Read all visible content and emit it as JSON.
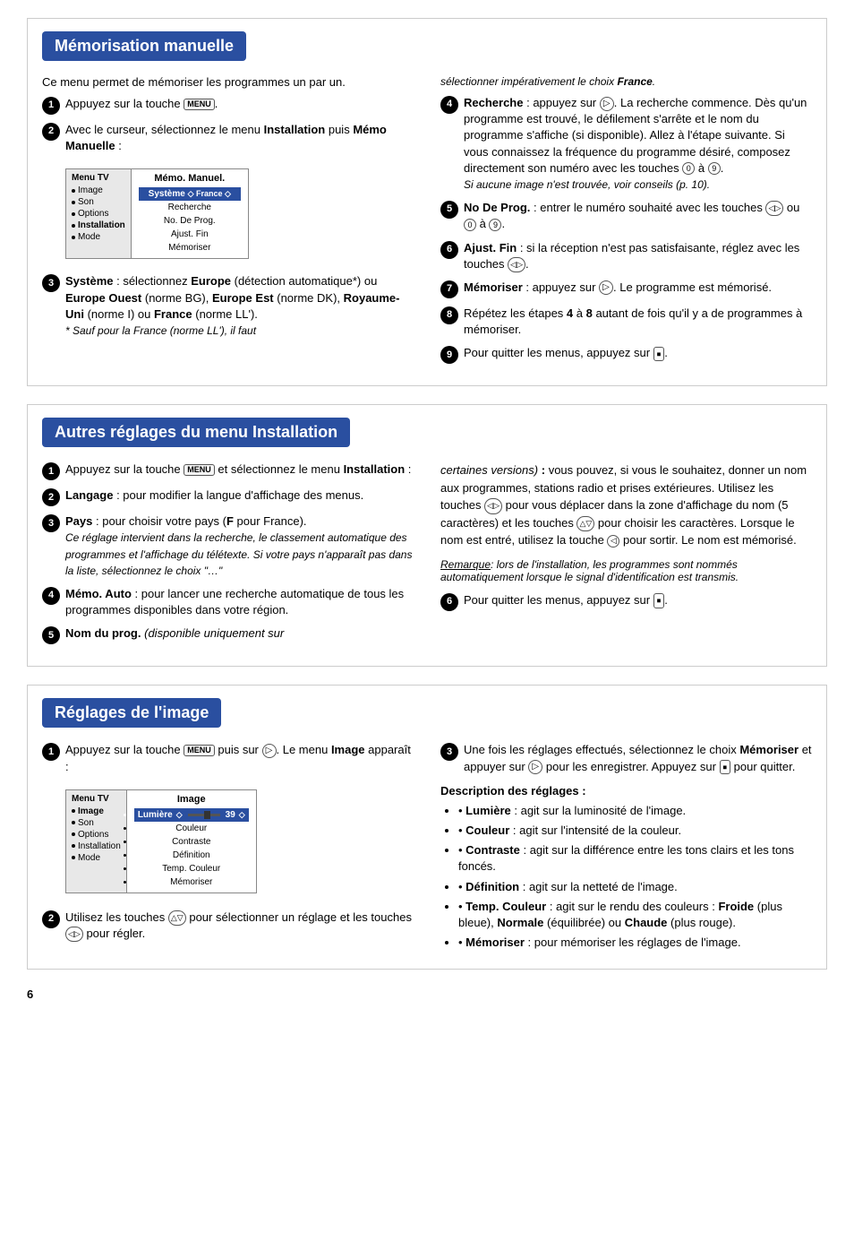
{
  "section1": {
    "title": "Mémorisation manuelle",
    "intro": "Ce menu permet de mémoriser les programmes un par un.",
    "steps_left": [
      {
        "num": "1",
        "text_parts": [
          {
            "type": "text",
            "content": "Appuyez sur la touche "
          },
          {
            "type": "icon",
            "icon": "menu"
          },
          {
            "type": "text",
            "content": "."
          }
        ]
      },
      {
        "num": "2",
        "text_parts": [
          {
            "type": "text",
            "content": "Avec le curseur, sélectionnez le menu "
          },
          {
            "type": "bold",
            "content": "Installation"
          },
          {
            "type": "text",
            "content": " puis "
          },
          {
            "type": "bold",
            "content": "Mémo Manuelle"
          },
          {
            "type": "text",
            "content": " :"
          }
        ]
      },
      {
        "num": "3",
        "text_parts": [
          {
            "type": "bold",
            "content": "Système"
          },
          {
            "type": "text",
            "content": " : sélectionnez "
          },
          {
            "type": "bold",
            "content": "Europe"
          },
          {
            "type": "text",
            "content": " (détection automatique*) ou "
          },
          {
            "type": "bold",
            "content": "Europe Ouest"
          },
          {
            "type": "text",
            "content": " (norme BG), "
          },
          {
            "type": "bold",
            "content": "Europe Est"
          },
          {
            "type": "text",
            "content": " (norme DK), "
          },
          {
            "type": "bold",
            "content": "Royaume-Uni"
          },
          {
            "type": "text",
            "content": " (norme I) ou "
          },
          {
            "type": "bold",
            "content": "France"
          },
          {
            "type": "text",
            "content": " (norme LL')."
          }
        ],
        "note": "* Sauf pour la France (norme LL'), il faut"
      }
    ],
    "steps_right": [
      {
        "pre_note": "sélectionner impérativement le choix France.",
        "num": "4",
        "text_parts": [
          {
            "type": "bold",
            "content": "Recherche"
          },
          {
            "type": "text",
            "content": " : appuyez sur "
          },
          {
            "type": "icon",
            "icon": "circle-right"
          },
          {
            "type": "text",
            "content": ". La recherche commence. Dès qu'un programme est trouvé, le défilement s'arrête et le nom du programme s'affiche (si disponible). Allez à l'étape suivante. Si vous connaissez la fréquence du programme désiré, composez directement son numéro avec les touches "
          },
          {
            "type": "icon",
            "icon": "0"
          },
          {
            "type": "text",
            "content": " à "
          },
          {
            "type": "icon",
            "icon": "9"
          },
          {
            "type": "text",
            "content": "."
          }
        ],
        "sub_note": "Si aucune image n'est trouvée, voir conseils (p. 10)."
      },
      {
        "num": "5",
        "text_parts": [
          {
            "type": "bold",
            "content": "No De Prog."
          },
          {
            "type": "text",
            "content": " : entrer le numéro souhaité avec les touches "
          },
          {
            "type": "icon",
            "icon": "arrow-lr"
          },
          {
            "type": "text",
            "content": " ou "
          },
          {
            "type": "icon",
            "icon": "0"
          },
          {
            "type": "text",
            "content": " à "
          },
          {
            "type": "icon",
            "icon": "9"
          },
          {
            "type": "text",
            "content": "."
          }
        ]
      },
      {
        "num": "6",
        "text_parts": [
          {
            "type": "bold",
            "content": "Ajust. Fin"
          },
          {
            "type": "text",
            "content": " : si la réception n'est pas satisfaisante, réglez avec les touches "
          },
          {
            "type": "icon",
            "icon": "arrow-lr"
          },
          {
            "type": "text",
            "content": "."
          }
        ]
      },
      {
        "num": "7",
        "text_parts": [
          {
            "type": "bold",
            "content": "Mémoriser"
          },
          {
            "type": "text",
            "content": " : appuyez sur "
          },
          {
            "type": "icon",
            "icon": "circle-right"
          },
          {
            "type": "text",
            "content": ". Le programme est mémorisé."
          }
        ]
      },
      {
        "num": "8",
        "text_parts": [
          {
            "type": "text",
            "content": "Répétez les étapes "
          },
          {
            "type": "bold",
            "content": "4"
          },
          {
            "type": "text",
            "content": " à "
          },
          {
            "type": "bold",
            "content": "8"
          },
          {
            "type": "text",
            "content": " autant de fois qu'il y a de programmes à mémoriser."
          }
        ]
      },
      {
        "num": "9",
        "text_parts": [
          {
            "type": "text",
            "content": "Pour quitter les menus, appuyez sur "
          },
          {
            "type": "icon",
            "icon": "exit"
          },
          {
            "type": "text",
            "content": "."
          }
        ]
      }
    ],
    "menu_left_title": "Menu TV",
    "menu_left_items": [
      "Image",
      "Son",
      "Options",
      "Installation",
      "Mode"
    ],
    "menu_right_title": "Mémo. Manuel.",
    "menu_right_items": [
      "Système",
      "Recherche",
      "No. De Prog.",
      "Ajust. Fin",
      "Mémoriser"
    ],
    "menu_france_label": "◇ France ◇"
  },
  "section2": {
    "title": "Autres réglages du menu Installation",
    "steps_left": [
      {
        "num": "1",
        "text": "Appuyez sur la touche MENU et sélectionnez le menu Installation :"
      },
      {
        "num": "2",
        "text": "Langage : pour modifier la langue d'affichage des menus."
      },
      {
        "num": "3",
        "text": "Pays : pour choisir votre pays (F pour France). Ce réglage intervient dans la recherche, le classement automatique des programmes et l'affichage du télétexte. Si votre pays n'apparaît pas dans la liste, sélectionnez le choix \"…\""
      },
      {
        "num": "4",
        "text": "Mémo. Auto : pour lancer une recherche automatique de tous les programmes disponibles dans votre région."
      },
      {
        "num": "5",
        "text": "Nom du prog. (disponible uniquement sur"
      }
    ],
    "steps_right": [
      {
        "pre_note": "certaines versions) : vous pouvez, si vous le souhaitez, donner un nom aux programmes, stations radio et prises extérieures. Utilisez les touches ◁▷ pour vous déplacer dans la zone d'affichage du nom (5 caractères) et les touches △▽ pour choisir les caractères. Lorsque le nom est entré, utilisez la touche ◁ pour sortir. Le nom est mémorisé.",
        "sub_note": "Remarque: lors de l'installation, les programmes sont nommés automatiquement lorsque le signal d'identification est transmis."
      },
      {
        "num": "6",
        "text": "Pour quitter les menus, appuyez sur ⏹."
      }
    ]
  },
  "section3": {
    "title": "Réglages de l'image",
    "steps_left": [
      {
        "num": "1",
        "text": "Appuyez sur la touche MENU puis sur ▷. Le menu Image apparaît :"
      }
    ],
    "steps_left2": [
      {
        "num": "2",
        "text": "Utilisez les touches △▽ pour sélectionner un réglage et les touches ◁▷ pour régler."
      }
    ],
    "steps_right": [
      {
        "num": "3",
        "text": "Une fois les réglages effectués, sélectionnez le choix Mémoriser et appuyer sur ▷ pour les enregistrer. Appuyez sur ⏹ pour quitter."
      }
    ],
    "desc_title": "Description des réglages :",
    "desc_items": [
      "Lumière : agit sur la luminosité de l'image.",
      "Couleur : agit sur l'intensité de la couleur.",
      "Contraste : agit sur la différence entre les tons clairs et les tons foncés.",
      "Définition : agit sur la netteté de l'image.",
      "Temp. Couleur : agit sur le rendu des couleurs : Froide (plus bleue), Normale (équilibrée) ou Chaude (plus rouge).",
      "Mémoriser : pour mémoriser les réglages de l'image."
    ],
    "menu_left_title": "Menu TV",
    "menu_left_items": [
      "Image",
      "Son",
      "Options",
      "Installation",
      "Mode"
    ],
    "menu_right_title": "Image",
    "menu_right_items": [
      "Lumière",
      "Couleur",
      "Contraste",
      "Définition",
      "Temp. Couleur",
      "Mémoriser"
    ],
    "lumiere_value": "39"
  },
  "page_num": "6"
}
